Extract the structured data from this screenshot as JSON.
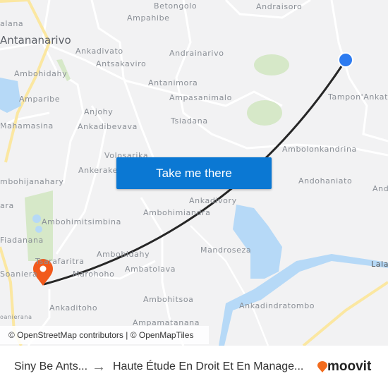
{
  "map": {
    "labels": {
      "betongolo": "Betongolo",
      "ampahibe": "Ampahibe",
      "andraisoro": "Andraisoro",
      "alana": "alana",
      "antananarivo": "Antananarivo",
      "ankadivato": "Ankadivato",
      "andrainarivo": "Andrainarivo",
      "antsakaviro": "Antsakaviro",
      "ambohidahy1": "Ambohidahy",
      "antanimora": "Antanimora",
      "ampasanimalo": "Ampasanimalo",
      "amparibe": "Amparibe",
      "tampon": "Tampon'Ankat",
      "anjohy": "Anjohy",
      "mahamasina": "Mahamasina",
      "ankadibevava": "Ankadibevava",
      "tsiadana": "Tsiadana",
      "volosarika": "Volosarika",
      "ambolonkandrina": "Ambolonkandrina",
      "ankerake": "Ankerake",
      "ambohijanahary": "mbohijanahary",
      "andohaniato": "Andohaniato",
      "and": "And",
      "ara": "ara",
      "ankadivory": "Ankadivory",
      "ambohimiandra": "Ambohimiandra",
      "ambohimitsimbina": "Ambohimitsimbina",
      "fiadanana": "Fiadanana",
      "mandroseza": "Mandroseza",
      "ambohidahy2": "Ambohidahy",
      "tsarafaritra": "Tsarafaritra",
      "lalav": "Lalav",
      "ambatolava": "Ambatolava",
      "soaniera": "Soaniera",
      "marohoho": "Marohoho",
      "ambohitsoa": "Ambohitsoa",
      "ankaditoho": "Ankaditoho",
      "ankadindratombo": "Ankadindratombo",
      "ampamatanana": "Ampamatanana",
      "soanierana": "oanierana"
    },
    "route_color": "#262626",
    "origin_marker_color": "#2d7bf0",
    "destination_marker_color": "#f25a1c",
    "cta_label": "Take me there",
    "attribution": "© OpenStreetMap contributors | © OpenMapTiles"
  },
  "footer": {
    "origin": "Siny Be Ants...",
    "arrow": "→",
    "destination": "Haute Étude En Droit Et En Manage...",
    "brand": "moovit",
    "brand_color": "#f26b1d"
  }
}
